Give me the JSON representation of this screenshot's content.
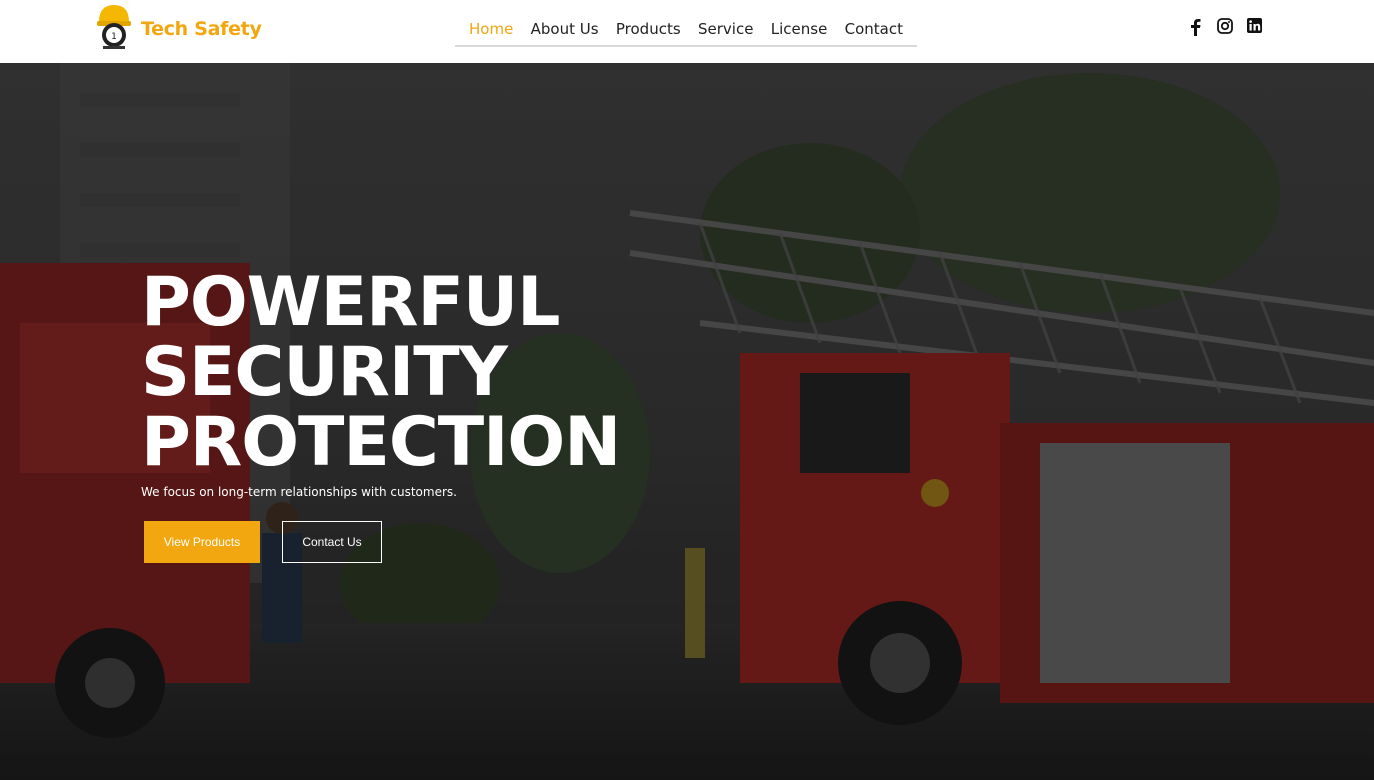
{
  "brand": {
    "name": "Tech Safety"
  },
  "nav": {
    "items": [
      {
        "label": "Home",
        "active": true
      },
      {
        "label": "About Us"
      },
      {
        "label": "Products"
      },
      {
        "label": "Service"
      },
      {
        "label": "License"
      },
      {
        "label": "Contact"
      }
    ]
  },
  "social": {
    "icons": [
      "facebook-icon",
      "instagram-icon",
      "linkedin-icon"
    ]
  },
  "hero": {
    "headline": [
      "POWERFUL",
      "SECURITY",
      "PROTECTION"
    ],
    "subtitle": "We focus on long-term relationships with customers.",
    "primary_button": "View Products",
    "secondary_button": "Contact Us"
  },
  "colors": {
    "accent": "#f2a60f",
    "header_bg": "#ffffff"
  }
}
